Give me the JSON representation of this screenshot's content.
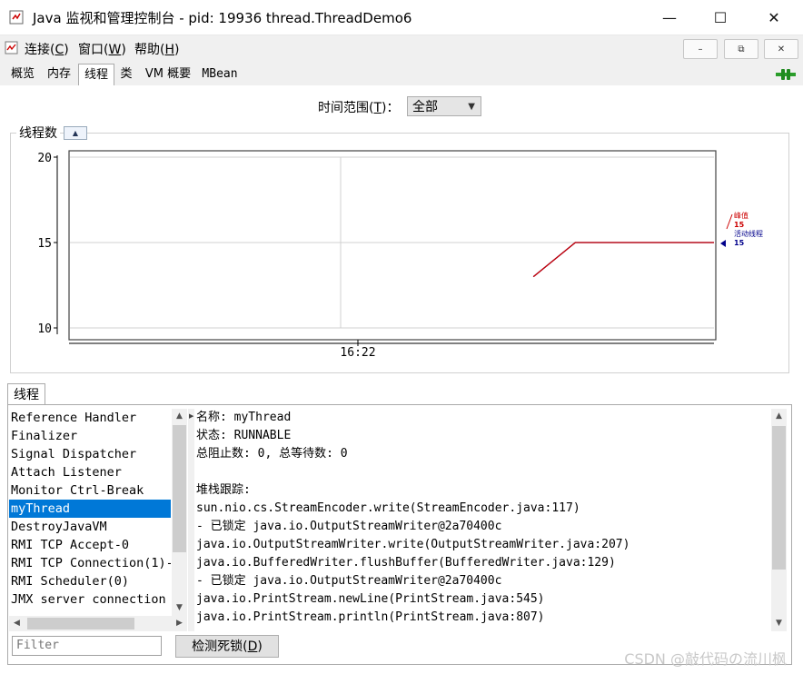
{
  "window": {
    "title": "Java 监视和管理控制台 - pid: 19936 thread.ThreadDemo6",
    "minimize": "—",
    "maximize": "☐",
    "close": "✕"
  },
  "menu": {
    "items": [
      {
        "label": "连接(",
        "key": "C",
        "tail": ")"
      },
      {
        "label": "窗口(",
        "key": "W",
        "tail": ")"
      },
      {
        "label": "帮助(",
        "key": "H",
        "tail": ")"
      }
    ],
    "mdi_minimize": "–",
    "mdi_restore": "⧉",
    "mdi_close": "✕"
  },
  "tabs": [
    {
      "label": "概览"
    },
    {
      "label": "内存"
    },
    {
      "label": "线程",
      "active": true
    },
    {
      "label": "类"
    },
    {
      "label": "VM 概要"
    },
    {
      "label": "MBean"
    }
  ],
  "time_range": {
    "label_pre": "时间范围(",
    "label_key": "T",
    "label_post": ")：",
    "selected": "全部"
  },
  "chart_panel": {
    "title": "线程数",
    "collapse_icon": "chevron-up-double-icon"
  },
  "chart_data": {
    "type": "line",
    "y_ticks": [
      10,
      15,
      20
    ],
    "ylim": [
      10,
      20
    ],
    "x_tick_label": "16:22",
    "series": [
      {
        "name": "峰值",
        "color": "#cc0000",
        "current": 15,
        "points": [
          [
            0.72,
            13
          ],
          [
            0.785,
            15
          ],
          [
            1.0,
            15
          ]
        ]
      },
      {
        "name": "活动线程",
        "color": "#00008b",
        "current": 15,
        "points": [
          [
            0.72,
            13
          ],
          [
            0.785,
            15
          ],
          [
            1.0,
            15
          ]
        ]
      }
    ],
    "grid": true
  },
  "threads": {
    "tab_label": "线程",
    "list": [
      "Reference Handler",
      "Finalizer",
      "Signal Dispatcher",
      "Attach Listener",
      "Monitor Ctrl-Break",
      "myThread",
      "DestroyJavaVM",
      "RMI TCP Accept-0",
      "RMI TCP Connection(1)-",
      "RMI Scheduler(0)",
      "JMX server connection"
    ],
    "selected": "myThread",
    "detail": [
      "名称: myThread",
      "状态: RUNNABLE",
      "总阻止数: 0, 总等待数: 0",
      "",
      "堆栈跟踪:",
      "sun.nio.cs.StreamEncoder.write(StreamEncoder.java:117)",
      "   - 已锁定 java.io.OutputStreamWriter@2a70400c",
      "java.io.OutputStreamWriter.write(OutputStreamWriter.java:207)",
      "java.io.BufferedWriter.flushBuffer(BufferedWriter.java:129)",
      "   - 已锁定 java.io.OutputStreamWriter@2a70400c",
      "java.io.PrintStream.newLine(PrintStream.java:545)",
      "java.io.PrintStream.println(PrintStream.java:807)"
    ],
    "filter_placeholder": "Filter",
    "deadlock_button_pre": "检测死锁(",
    "deadlock_button_key": "D",
    "deadlock_button_post": ")"
  },
  "watermark": "CSDN @敲代码の流川枫"
}
